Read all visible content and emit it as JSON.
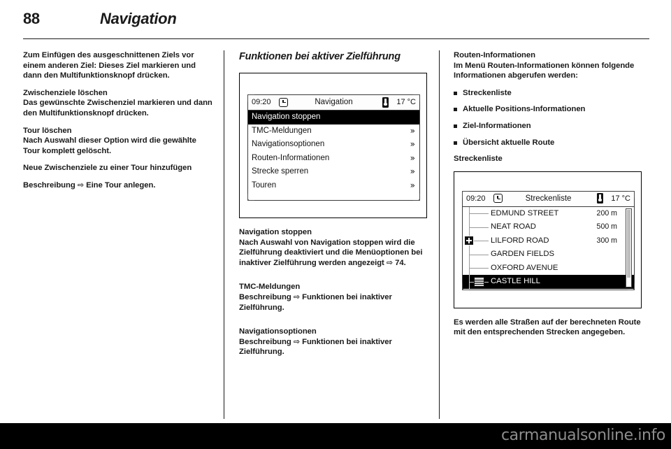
{
  "header": {
    "page_number": "88",
    "title": "Navigation"
  },
  "footer": {
    "watermark": "carmanualsonline.info"
  },
  "column_left": {
    "para_1": "Zum Einfügen des ausgeschnittenen Ziels vor einem anderen Ziel: Dieses Ziel markieren und dann den Multifunktionsknopf drücken.",
    "head_1": "Zwischenziele löschen",
    "para_2": "Das gewünschte Zwischenziel markieren und dann den Multifunktionsknopf drücken.",
    "head_2": "Tour löschen",
    "para_3": "Nach Auswahl dieser Option wird die gewählte Tour komplett gelöscht.",
    "head_3": "Neue Zwischenziele zu einer Tour hinzufügen",
    "para_4_pre": "Beschreibung ",
    "para_4_arrow": "⇨",
    "para_4_post": " Eine Tour anlegen."
  },
  "column_middle": {
    "section_head": "Funktionen bei aktiver Zielführung",
    "nav_screen": {
      "statusbar": {
        "time": "09:20",
        "clock_icon": "clock-icon",
        "title": "Navigation",
        "thermometer_icon": "thermometer-icon",
        "temperature": "17 °C"
      },
      "items": [
        {
          "label": "Navigation stoppen",
          "selected": true,
          "chevron": ""
        },
        {
          "label": "TMC-Meldungen",
          "selected": false,
          "chevron": "»"
        },
        {
          "label": "Navigationsoptionen",
          "selected": false,
          "chevron": "»"
        },
        {
          "label": "Routen-Informationen",
          "selected": false,
          "chevron": "»"
        },
        {
          "label": "Strecke sperren",
          "selected": false,
          "chevron": "»"
        },
        {
          "label": "Touren",
          "selected": false,
          "chevron": "»"
        }
      ]
    },
    "head_1": "Navigation stoppen",
    "para_1_pre": "Nach Auswahl von Navigation stoppen wird die Zielführung deaktiviert und die Menüoptionen bei inaktiver Zielführung werden angezeigt ",
    "para_1_arrow": "⇨",
    "para_1_post": " 74.",
    "head_2": "TMC-Meldungen",
    "para_2_pre": "Beschreibung ",
    "para_2_arrow": "⇨",
    "para_2_post": " Funktionen bei inaktiver Zielführung.",
    "head_3": "Navigationsoptionen",
    "para_3_pre": "Beschreibung ",
    "para_3_arrow": "⇨",
    "para_3_post": " Funktionen bei inaktiver Zielführung."
  },
  "column_right": {
    "head_1": "Routen-Informationen",
    "para_1": "Im Menü Routen-Informationen können folgende Informationen abgerufen werden:",
    "bullets": [
      "Streckenliste",
      "Aktuelle Positions-Informationen",
      "Ziel-Informationen",
      "Übersicht aktuelle Route"
    ],
    "head_2": "Streckenliste",
    "route_screen": {
      "statusbar": {
        "time": "09:20",
        "clock_icon": "clock-icon",
        "title": "Streckenliste",
        "thermometer_icon": "thermometer-icon",
        "temperature": "17 °C"
      },
      "rows": [
        {
          "name": "EDMUND STREET",
          "distance": "200 m",
          "icon": "",
          "selected": false
        },
        {
          "name": "NEAT ROAD",
          "distance": "500 m",
          "icon": "",
          "selected": false
        },
        {
          "name": "LILFORD ROAD",
          "distance": "300 m",
          "icon": "plus-icon",
          "selected": false
        },
        {
          "name": "GARDEN FIELDS",
          "distance": "",
          "icon": "",
          "selected": false
        },
        {
          "name": "OXFORD AVENUE",
          "distance": "",
          "icon": "",
          "selected": false
        },
        {
          "name": "CASTLE HILL",
          "distance": "",
          "icon": "finish-flag-icon",
          "selected": true
        }
      ]
    },
    "para_2": "Es werden alle Straßen auf der berechneten Route mit den entsprechenden Strecken angegeben."
  }
}
